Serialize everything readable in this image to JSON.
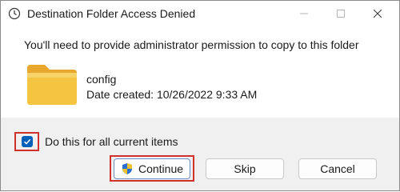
{
  "window": {
    "title": "Destination Folder Access Denied",
    "minimize_label": "—",
    "maximize_label": "☐",
    "close_label": "✕"
  },
  "dialog": {
    "message": "You'll need to provide administrator permission to copy to this folder",
    "item": {
      "name": "config",
      "date_created": "Date created: 10/26/2022 9:33 AM"
    },
    "apply_all": {
      "label": "Do this for all current items",
      "checked": true
    },
    "buttons": {
      "continue": "Continue",
      "skip": "Skip",
      "cancel": "Cancel"
    }
  },
  "colors": {
    "accent": "#005fb8",
    "highlight_outline": "#d0312d",
    "folder": "#f5c542",
    "footer_bg": "#f0f0f0"
  },
  "icons": {
    "app": "clock-icon",
    "item": "folder-icon",
    "continue": "uac-shield-icon"
  }
}
